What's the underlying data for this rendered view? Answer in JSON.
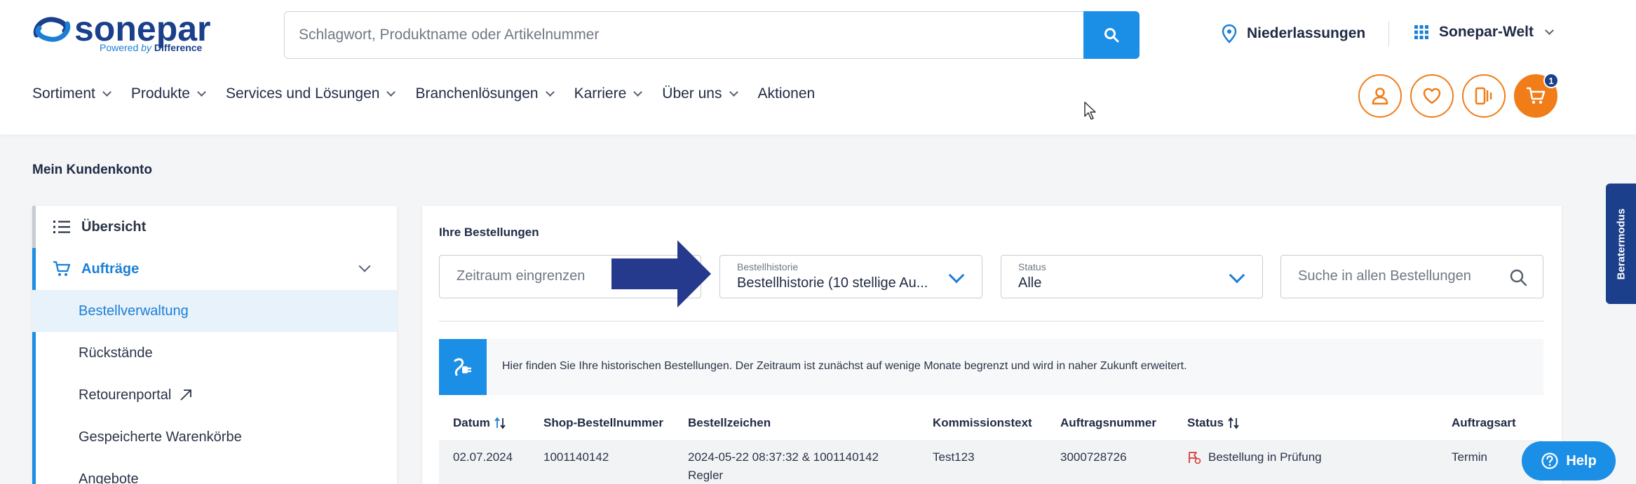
{
  "header": {
    "logo_text": "sonepar",
    "logo_sub_prefix": "Powered",
    "logo_sub_by": "by",
    "logo_sub_brand": "Difference",
    "search_placeholder": "Schlagwort, Produktname oder Artikelnummer",
    "niederlassungen_label": "Niederlassungen",
    "welt_label": "Sonepar-Welt",
    "cart_count": "1",
    "accent_color": "#f07d18",
    "brand_color": "#1b3f8b"
  },
  "nav": {
    "items": [
      {
        "label": "Sortiment"
      },
      {
        "label": "Produkte"
      },
      {
        "label": "Services und Lösungen"
      },
      {
        "label": "Branchenlösungen"
      },
      {
        "label": "Karriere"
      },
      {
        "label": "Über uns"
      },
      {
        "label": "Aktionen"
      }
    ]
  },
  "page": {
    "title": "Mein Kundenkonto"
  },
  "sidebar": {
    "items": [
      {
        "label": "Übersicht"
      },
      {
        "label": "Aufträge"
      },
      {
        "label": "Bestellverwaltung"
      },
      {
        "label": "Rückstände"
      },
      {
        "label": "Retourenportal"
      },
      {
        "label": "Gespeicherte Warenkörbe"
      },
      {
        "label": "Angebote"
      }
    ]
  },
  "orders": {
    "title": "Ihre Bestellungen",
    "zeitraum_placeholder": "Zeitraum eingrenzen",
    "historie_label": "Bestellhistorie",
    "historie_value": "Bestellhistorie (10 stellige Au...",
    "status_label": "Status",
    "status_value": "Alle",
    "search_placeholder": "Suche in allen Bestellungen",
    "info_text": "Hier finden Sie Ihre historischen Bestellungen. Der Zeitraum ist zunächst auf wenige Monate begrenzt und wird in naher Zukunft erweitert.",
    "columns": [
      "Datum",
      "Shop-Bestellnummer",
      "Bestellzeichen",
      "Kommissionstext",
      "Auftragsnummer",
      "Status",
      "Auftragsart"
    ],
    "rows": [
      {
        "datum": "02.07.2024",
        "shop_nr": "1001140142",
        "zeichen_line1": "2024-05-22 08:37:32 & 1001140142",
        "zeichen_line2": "Regler",
        "kommission": "Test123",
        "auftragsnr": "3000728726",
        "status": "Bestellung in Prüfung",
        "art": "Termin"
      }
    ]
  },
  "berater": {
    "label": "Beratermodus"
  },
  "help": {
    "label": "Help"
  }
}
